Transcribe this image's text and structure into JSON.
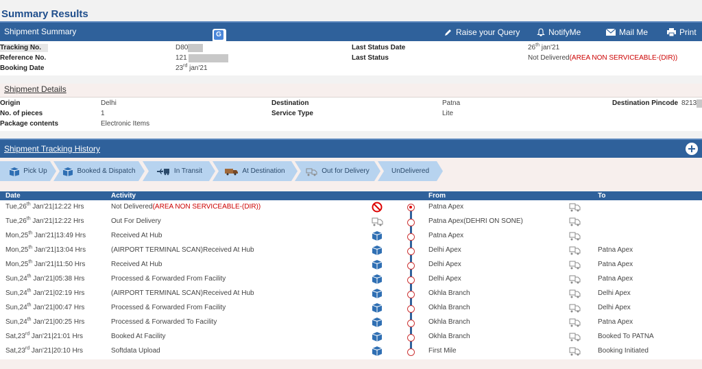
{
  "page_title": "Summary Results",
  "summary": {
    "bar_title": "Shipment Summary",
    "actions": {
      "raise_query": "Raise your Query",
      "notify": "NotifyMe",
      "mail": "Mail Me",
      "print": "Print"
    },
    "tracking_label": "Tracking No.",
    "tracking_value": "D80",
    "reference_label": "Reference No.",
    "reference_value": "121",
    "booking_label": "Booking Date",
    "booking_day": "23",
    "booking_suffix": "rd",
    "booking_rest": " jan'21",
    "last_status_date_label": "Last Status Date",
    "last_status_date_day": "26",
    "last_status_date_suffix": "th",
    "last_status_date_rest": " jan'21",
    "last_status_label": "Last Status",
    "last_status_value": "Not Delivered",
    "last_status_reason": "(AREA NON SERVICEABLE-(DIR))"
  },
  "details": {
    "heading": "Shipment Details",
    "origin_label": "Origin",
    "origin_value": "Delhi",
    "pieces_label": "No. of pieces",
    "pieces_value": "1",
    "contents_label": "Package contents",
    "contents_value": "Electronic Items",
    "destination_label": "Destination",
    "destination_value": "Patna",
    "service_label": "Service Type",
    "service_value": "Lite",
    "pincode_label": "Destination Pincode",
    "pincode_value": "8213"
  },
  "history": {
    "bar_title": "Shipment Tracking History",
    "steps": [
      {
        "label": "Pick Up",
        "icon": "package-icon"
      },
      {
        "label": "Booked & Dispatch",
        "icon": "package-icon"
      },
      {
        "label": "In Transit",
        "icon": "transit-icon"
      },
      {
        "label": "At Destination",
        "icon": "truck-icon"
      },
      {
        "label": "Out for Delivery",
        "icon": "delivery-icon"
      },
      {
        "label": "UnDelivered",
        "icon": ""
      }
    ],
    "columns": {
      "date": "Date",
      "activity": "Activity",
      "from": "From",
      "to": "To"
    },
    "rows": [
      {
        "day": "Tue,26",
        "sup": "th",
        "rest": " Jan'21|12:22 Hrs",
        "activity": "Not Delivered",
        "reason": "(AREA NON SERVICEABLE-(DIR))",
        "icon": "blocked-icon",
        "from": "Patna Apex",
        "to": ""
      },
      {
        "day": "Tue,26",
        "sup": "th",
        "rest": " Jan'21|12:22 Hrs",
        "activity": "Out For Delivery",
        "reason": "",
        "icon": "delivery-icon",
        "from": "Patna Apex(DEHRI ON SONE)",
        "to": ""
      },
      {
        "day": "Mon,25",
        "sup": "th",
        "rest": " Jan'21|13:49 Hrs",
        "activity": "Received At Hub",
        "reason": "",
        "icon": "package-icon",
        "from": "Patna Apex",
        "to": ""
      },
      {
        "day": "Mon,25",
        "sup": "th",
        "rest": " Jan'21|13:04 Hrs",
        "activity": "(AIRPORT TERMINAL SCAN)Received At Hub",
        "reason": "",
        "icon": "package-icon",
        "from": "Delhi Apex",
        "to": "Patna Apex"
      },
      {
        "day": "Mon,25",
        "sup": "th",
        "rest": " Jan'21|11:50 Hrs",
        "activity": "Received At Hub",
        "reason": "",
        "icon": "package-icon",
        "from": "Delhi Apex",
        "to": "Patna Apex"
      },
      {
        "day": "Sun,24",
        "sup": "th",
        "rest": " Jan'21|05:38 Hrs",
        "activity": "Processed & Forwarded From Facility",
        "reason": "",
        "icon": "package-icon",
        "from": "Delhi Apex",
        "to": "Patna Apex"
      },
      {
        "day": "Sun,24",
        "sup": "th",
        "rest": " Jan'21|02:19 Hrs",
        "activity": "(AIRPORT TERMINAL SCAN)Received At Hub",
        "reason": "",
        "icon": "package-icon",
        "from": "Okhla Branch",
        "to": "Delhi Apex"
      },
      {
        "day": "Sun,24",
        "sup": "th",
        "rest": " Jan'21|00:47 Hrs",
        "activity": "Processed & Forwarded From Facility",
        "reason": "",
        "icon": "package-icon",
        "from": "Okhla Branch",
        "to": "Delhi Apex"
      },
      {
        "day": "Sun,24",
        "sup": "th",
        "rest": " Jan'21|00:25 Hrs",
        "activity": "Processed & Forwarded To Facility",
        "reason": "",
        "icon": "package-icon",
        "from": "Okhla Branch",
        "to": "Patna Apex"
      },
      {
        "day": "Sat,23",
        "sup": "rd",
        "rest": " Jan'21|21:01 Hrs",
        "activity": "Booked At Facility",
        "reason": "",
        "icon": "package-icon",
        "from": "Okhla Branch",
        "to": "Booked To PATNA"
      },
      {
        "day": "Sat,23",
        "sup": "rd",
        "rest": " Jan'21|20:10 Hrs",
        "activity": "Softdata Upload",
        "reason": "",
        "icon": "package-icon",
        "from": "First Mile",
        "to": "Booking Initiated"
      }
    ]
  },
  "colors": {
    "bar": "#2f619b",
    "step": "#b7d3ef",
    "alert": "#cc0000"
  }
}
